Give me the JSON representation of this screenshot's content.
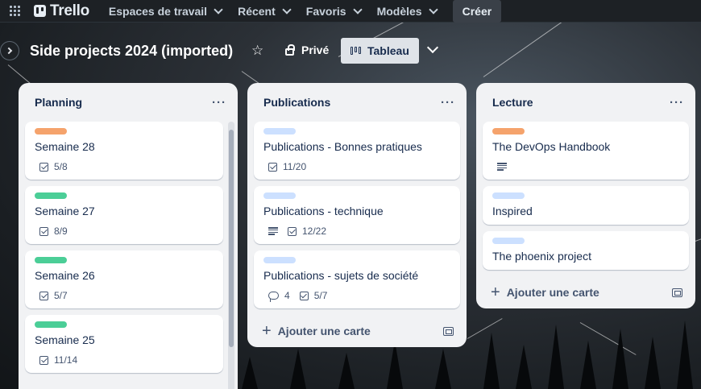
{
  "nav": {
    "logo": "Trello",
    "menus": [
      "Espaces de travail",
      "Récent",
      "Favoris",
      "Modèles"
    ],
    "create": "Créer"
  },
  "board": {
    "title": "Side projects 2024 (imported)",
    "visibility": "Privé",
    "view": "Tableau"
  },
  "colors": {
    "orange": "#f5a36c",
    "green": "#4bce97",
    "lightblue": "#cce0ff"
  },
  "lists": [
    {
      "title": "Planning",
      "cards": [
        {
          "title": "Semaine 28",
          "label_color": "#f5a36c",
          "checklist": "5/8"
        },
        {
          "title": "Semaine 27",
          "label_color": "#4bce97",
          "checklist": "8/9"
        },
        {
          "title": "Semaine 26",
          "label_color": "#4bce97",
          "checklist": "5/7"
        },
        {
          "title": "Semaine 25",
          "label_color": "#4bce97",
          "checklist": "11/14"
        }
      ]
    },
    {
      "title": "Publications",
      "cards": [
        {
          "title": "Publications - Bonnes pratiques",
          "label_color": "#cce0ff",
          "checklist": "11/20"
        },
        {
          "title": "Publications - technique",
          "label_color": "#cce0ff",
          "description": true,
          "checklist": "12/22"
        },
        {
          "title": "Publications - sujets de société",
          "label_color": "#cce0ff",
          "comments": "4",
          "checklist": "5/7"
        }
      ],
      "add_card": "Ajouter une carte"
    },
    {
      "title": "Lecture",
      "cards": [
        {
          "title": "The DevOps Handbook",
          "label_color": "#f5a36c",
          "description": true
        },
        {
          "title": "Inspired",
          "label_color": "#cce0ff"
        },
        {
          "title": "The phoenix project",
          "label_color": "#cce0ff"
        }
      ],
      "add_card": "Ajouter une carte"
    }
  ]
}
